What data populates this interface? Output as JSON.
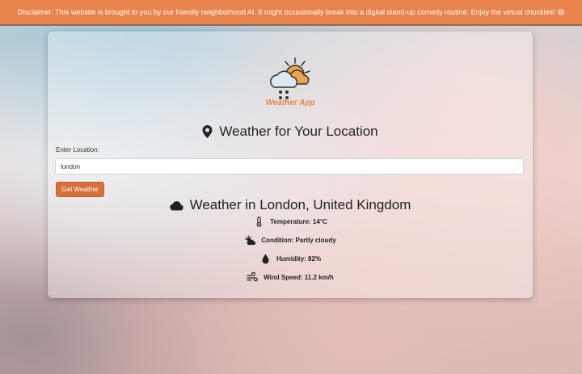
{
  "banner": {
    "text": "Disclaimer: This website is brought to you by our friendly neighborhood AI. It might occasionally break into a digital stand-up comedy routine. Enjoy the virtual chuckles! 😄"
  },
  "logo": {
    "text": "Weather App",
    "icon": "weather-logo-icon"
  },
  "location": {
    "title": "Weather for Your Location",
    "label": "Enter Location:",
    "value": "london",
    "button": "Get Weather"
  },
  "result": {
    "title": "Weather in London, United Kingdom",
    "temperature": "Temperature: 14°C",
    "condition": "Condition: Partly cloudy",
    "humidity": "Humidity: 82%",
    "wind": "Wind Speed: 11.2 km/h"
  },
  "colors": {
    "accent": "#e8834c",
    "button": "#d8703c"
  },
  "icons": [
    "map-marker-icon",
    "cloud-icon",
    "thermometer-icon",
    "partly-cloudy-icon",
    "droplet-icon",
    "wind-icon"
  ]
}
